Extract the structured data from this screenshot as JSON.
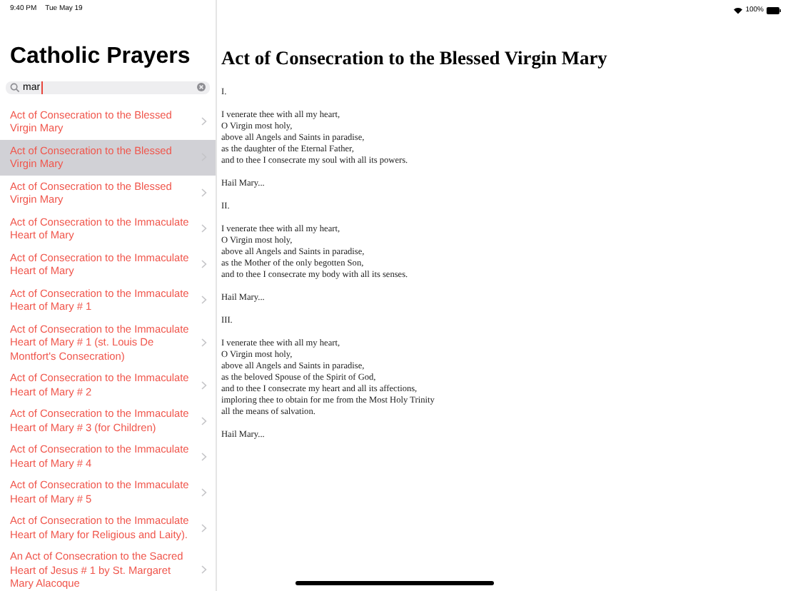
{
  "status_bar": {
    "time": "9:40 PM",
    "date": "Tue May 19",
    "battery": "100%"
  },
  "sidebar": {
    "title": "Catholic Prayers",
    "search": {
      "value": "mar"
    },
    "items": [
      {
        "label": "Act of Consecration to the Blessed Virgin Mary",
        "selected": false
      },
      {
        "label": "Act of Consecration to the Blessed Virgin Mary",
        "selected": true
      },
      {
        "label": "Act of Consecration to the Blessed Virgin Mary",
        "selected": false
      },
      {
        "label": "Act of Consecration to the Immaculate Heart of Mary",
        "selected": false
      },
      {
        "label": "Act of Consecration to the Immaculate Heart of Mary",
        "selected": false
      },
      {
        "label": "Act of Consecration to the Immaculate Heart of Mary # 1",
        "selected": false
      },
      {
        "label": "Act of Consecration to the Immaculate Heart of Mary # 1 (st. Louis De Montfort's Consecration)",
        "selected": false
      },
      {
        "label": "Act of Consecration to the Immaculate Heart of Mary # 2",
        "selected": false
      },
      {
        "label": "Act of Consecration to the Immaculate Heart of Mary # 3 (for Children)",
        "selected": false
      },
      {
        "label": "Act of Consecration to the Immaculate Heart of Mary # 4",
        "selected": false
      },
      {
        "label": "Act of Consecration to the Immaculate Heart of Mary # 5",
        "selected": false
      },
      {
        "label": "Act of Consecration to the Immaculate Heart of Mary for Religious and Laity).",
        "selected": false
      },
      {
        "label": "An Act of Consecration to the Sacred Heart of Jesus # 1 by St. Margaret Mary Alacoque",
        "selected": false
      }
    ]
  },
  "detail": {
    "title": "Act of Consecration to the Blessed Virgin Mary",
    "stanzas": [
      {
        "number": "I.",
        "lines": [
          "I venerate thee with all my heart,",
          "O Virgin most holy,",
          "above all Angels and Saints in paradise,",
          "as the daughter of the Eternal Father,",
          "and to thee I consecrate my soul with all its powers."
        ],
        "response": "Hail Mary..."
      },
      {
        "number": "II.",
        "lines": [
          "I venerate thee with all my heart,",
          "O Virgin most holy,",
          "above all Angels and Saints in paradise,",
          "as the Mother of the only begotten Son,",
          "and to thee I consecrate my body with all its senses."
        ],
        "response": "Hail Mary..."
      },
      {
        "number": "III.",
        "lines": [
          "I venerate thee with all my heart,",
          "O Virgin most holy,",
          "above all Angels and Saints in paradise,",
          "as the beloved Spouse of the Spirit of God,",
          "and to thee I consecrate my heart and all its affections,",
          "imploring thee to obtain for me from the Most Holy Trinity",
          "all the means of salvation."
        ],
        "response": "Hail Mary..."
      }
    ]
  }
}
